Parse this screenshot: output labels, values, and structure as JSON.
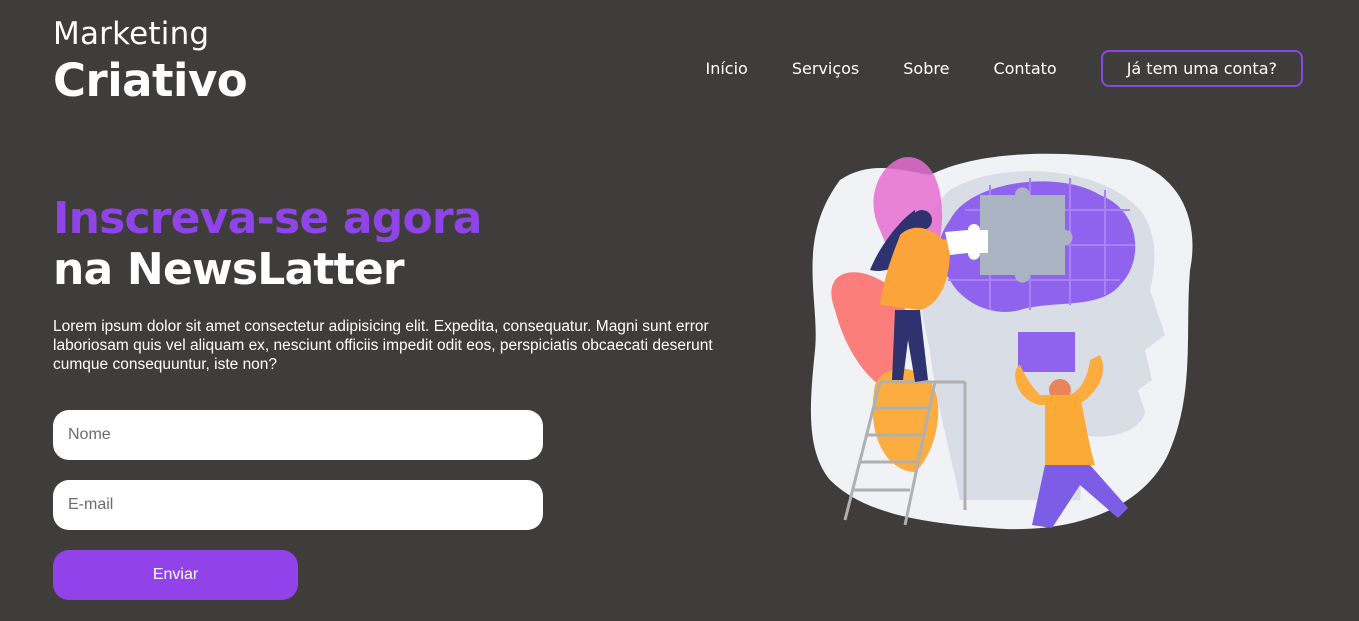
{
  "logo": {
    "line1": "Marketing",
    "line2": "Criativo"
  },
  "nav": {
    "items": [
      "Início",
      "Serviços",
      "Sobre",
      "Contato"
    ],
    "account_button": "Já tem uma conta?"
  },
  "hero": {
    "title_line1": "Inscreva-se agora",
    "title_line2": "na NewsLatter",
    "text": "Lorem ipsum dolor sit amet consectetur adipisicing elit. Expedita, consequatur. Magni sunt error laboriosam quis vel aliquam ex, nesciunt officiis impedit odit eos, perspiciatis obcaecati deserunt cumque consequuntur, iste non?"
  },
  "form": {
    "name_placeholder": "Nome",
    "name_value": "",
    "email_placeholder": "E-mail",
    "email_value": "",
    "submit_label": "Enviar"
  },
  "colors": {
    "background": "#3f3d3c",
    "accent": "#8e44e6",
    "button": "#9142e8",
    "text": "#ffffff"
  },
  "illustration": {
    "icon": "puzzle-head-illustration"
  }
}
